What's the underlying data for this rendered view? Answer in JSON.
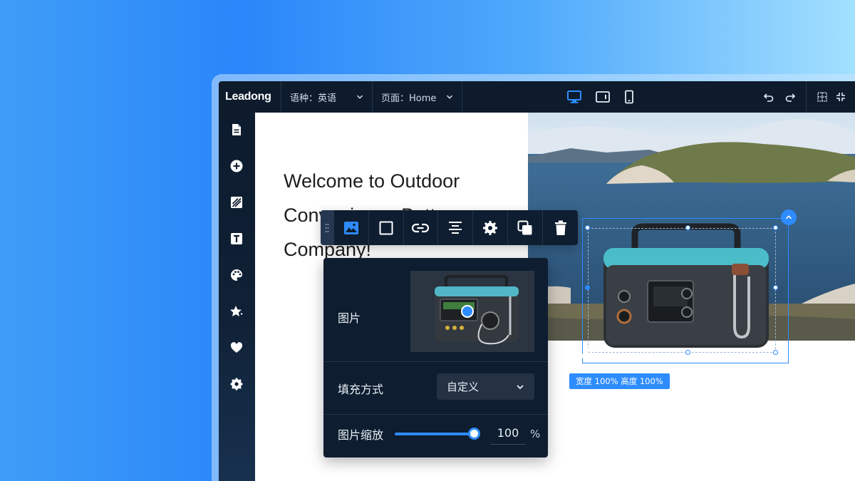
{
  "app": {
    "logo": "Leadong",
    "language_label": "语种：英语",
    "page_label": "页面：Home"
  },
  "canvas": {
    "headline": "Welcome to Outdoor Convenience Battery Company!"
  },
  "selection": {
    "size_badge": "宽度 100% 高度 100%"
  },
  "panel": {
    "image_label": "图片",
    "fill_label": "填充方式",
    "fill_value": "自定义",
    "zoom_label": "图片缩放",
    "zoom_value": "100",
    "zoom_unit": "%",
    "zoom_fraction": 1.0
  },
  "icons": {
    "sidebar": [
      "page-icon",
      "add-icon",
      "layout-icon",
      "text-icon",
      "palette-icon",
      "star-icon",
      "heart-icon",
      "settings-icon"
    ],
    "toolbar": [
      "image-icon",
      "border-icon",
      "link-icon",
      "align-center-icon",
      "settings-icon",
      "copy-icon",
      "delete-icon"
    ]
  },
  "colors": {
    "accent": "#2d8cff",
    "chrome": "#0d1b2d",
    "panel": "#0e1d30"
  }
}
